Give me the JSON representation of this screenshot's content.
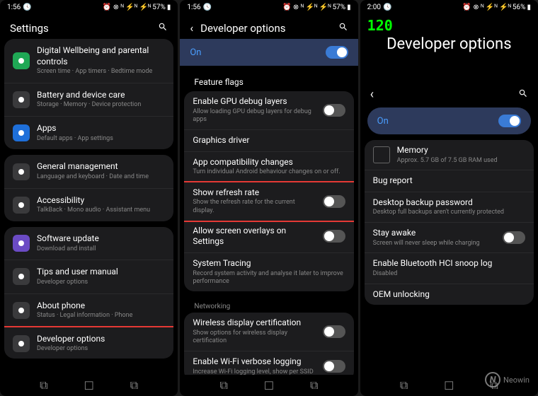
{
  "status": {
    "time1": "1:56",
    "time2": "1:56",
    "time3": "2:00",
    "batt1": "57%",
    "batt2": "57%",
    "batt3": "56%"
  },
  "p1": {
    "title": "Settings",
    "g1": [
      {
        "t": "Digital Wellbeing and parental controls",
        "s": "Screen time · App timers · Bedtime mode",
        "ic": "green"
      },
      {
        "t": "Battery and device care",
        "s": "Storage · Memory · Device protection",
        "ic": "dark"
      },
      {
        "t": "Apps",
        "s": "Default apps · App settings",
        "ic": "blue"
      }
    ],
    "g2": [
      {
        "t": "General management",
        "s": "Language and keyboard · Date and time",
        "ic": "dark"
      },
      {
        "t": "Accessibility",
        "s": "TalkBack · Mono audio · Assistant menu",
        "ic": "dark"
      }
    ],
    "g3": [
      {
        "t": "Software update",
        "s": "Download and install",
        "ic": "purple"
      },
      {
        "t": "Tips and user manual",
        "s": "Developer options",
        "ic": "dark"
      },
      {
        "t": "About phone",
        "s": "Status · Legal information · Phone",
        "ic": "dark"
      },
      {
        "t": "Developer options",
        "s": "Developer options",
        "ic": "dark",
        "hl": true
      }
    ]
  },
  "p2": {
    "title": "Developer options",
    "on": "On",
    "sec1": "Feature flags",
    "items": [
      {
        "t": "Enable GPU debug layers",
        "s": "Allow loading GPU debug layers for debug apps",
        "tog": false
      },
      {
        "t": "Graphics driver",
        "s": ""
      },
      {
        "t": "App compatibility changes",
        "s": "Turn individual Android behaviour changes on or off."
      },
      {
        "t": "Show refresh rate",
        "s": "Show the refresh rate for the current display.",
        "tog": false,
        "hl": true
      },
      {
        "t": "Allow screen overlays on Settings",
        "s": "",
        "tog": false
      },
      {
        "t": "System Tracing",
        "s": "Record system activity and analyse it later to improve performance"
      }
    ],
    "sec2": "Networking",
    "items2": [
      {
        "t": "Wireless display certification",
        "s": "Show options for wireless display certification",
        "tog": false
      },
      {
        "t": "Enable Wi-Fi verbose logging",
        "s": "Increase Wi-Fi logging level, show per SSID",
        "tog": false
      }
    ]
  },
  "p3": {
    "fps": "120",
    "title": "Developer options",
    "on": "On",
    "items": [
      {
        "t": "Memory",
        "s": "Approx. 5.7 GB of 7.5 GB RAM used",
        "ic": true
      },
      {
        "t": "Bug report",
        "s": ""
      },
      {
        "t": "Desktop backup password",
        "s": "Desktop full backups aren't currently protected"
      },
      {
        "t": "Stay awake",
        "s": "Screen will never sleep while charging",
        "tog": false
      },
      {
        "t": "Enable Bluetooth HCI snoop log",
        "s": "Disabled"
      },
      {
        "t": "OEM unlocking",
        "s": ""
      }
    ]
  },
  "wm": "Neowin"
}
